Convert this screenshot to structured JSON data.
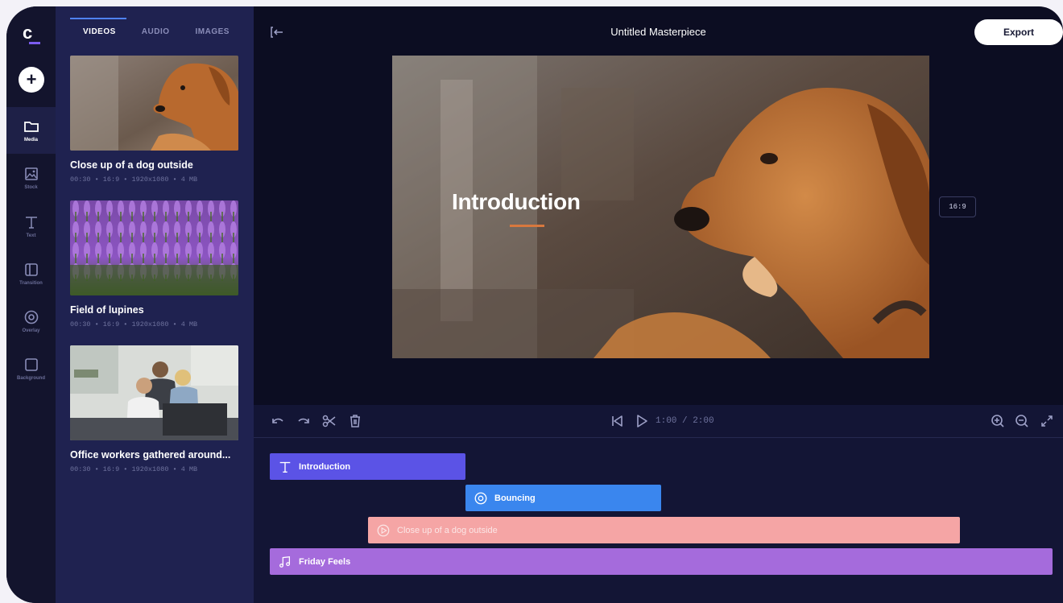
{
  "rail": {
    "items": [
      {
        "label": "Media",
        "icon": "folder-icon"
      },
      {
        "label": "Stock",
        "icon": "image-icon"
      },
      {
        "label": "Text",
        "icon": "text-icon"
      },
      {
        "label": "Transition",
        "icon": "transition-icon"
      },
      {
        "label": "Overlay",
        "icon": "overlay-icon"
      },
      {
        "label": "Background",
        "icon": "background-icon"
      }
    ]
  },
  "panel": {
    "tabs": [
      "VIDEOS",
      "AUDIO",
      "IMAGES"
    ],
    "active_tab": "VIDEOS",
    "items": [
      {
        "title": "Close up of a dog outside",
        "meta": "00:30 • 16:9 • 1920x1080 • 4 MB"
      },
      {
        "title": "Field of lupines",
        "meta": "00:30 • 16:9 • 1920x1080 • 4 MB"
      },
      {
        "title": "Office workers gathered around...",
        "meta": "00:30 • 16:9 • 1920x1080 • 4 MB"
      }
    ]
  },
  "header": {
    "title": "Untitled Masterpiece",
    "export_label": "Export"
  },
  "preview": {
    "overlay_text": "Introduction",
    "aspect_ratio": "16:9"
  },
  "controls": {
    "time": "1:00 / 2:00"
  },
  "timeline": {
    "clips": [
      {
        "label": "Introduction",
        "icon": "text-icon"
      },
      {
        "label": "Bouncing",
        "icon": "overlay-icon"
      },
      {
        "label": "Close up of a dog outside",
        "icon": "play-icon"
      },
      {
        "label": "Friday Feels",
        "icon": "music-icon"
      }
    ]
  },
  "colors": {
    "background": "#0c0d22",
    "rail": "#13142d",
    "panel": "#1f2250",
    "clip_text": "#5b53e6",
    "clip_overlay": "#3a86ee",
    "clip_video": "#f5a5a5",
    "clip_audio": "#a56bdc",
    "accent": "#7b5cf0"
  }
}
